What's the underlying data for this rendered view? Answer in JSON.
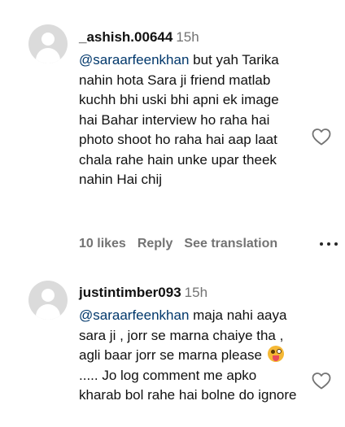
{
  "comments": [
    {
      "username": "_ashish.00644",
      "time": "15h",
      "mention": "@saraarfeenkhan",
      "text": " but yah Tarika nahin hota Sara ji friend matlab kuchh bhi uski bhi apni ek image hai Bahar interview ho raha hai photo shoot ho raha hai aap laat chala rahe hain unke upar theek nahin Hai chij",
      "likes": "10 likes",
      "reply": "Reply",
      "see_translation": "See translation"
    },
    {
      "username": "justintimber093",
      "time": "15h",
      "mention": "@saraarfeenkhan",
      "text_before_emoji": " maja nahi aaya sara ji , jorr se marna chaiye tha , agli baar jorr se marna please ",
      "emoji": "zany-face",
      "text_after_emoji": " ..... Jo log comment me apko kharab bol rahe hai bolne do ignore"
    }
  ],
  "icons": {
    "like": "heart-outline-icon",
    "more": "more-horizontal-icon",
    "avatar": "default-avatar-icon"
  },
  "colors": {
    "mention": "#00376b",
    "secondary_text": "#737373",
    "avatar_bg": "#dbdbdb"
  }
}
